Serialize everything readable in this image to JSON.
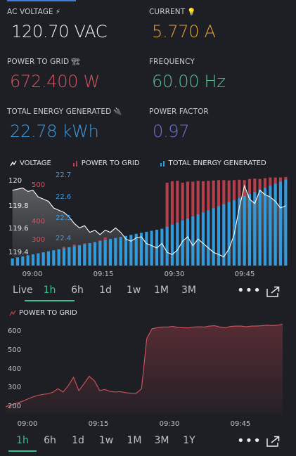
{
  "metrics": [
    {
      "label": "AC VOLTAGE",
      "icon": "lightning-icon",
      "icon_glyph": "⚡",
      "value": "120.70 VAC",
      "color": "#f2f3f5"
    },
    {
      "label": "CURRENT",
      "icon": "lightbulb-icon",
      "icon_glyph": "💡",
      "value": "5.770 A",
      "color": "#e3a03c"
    },
    {
      "label": "POWER TO GRID",
      "icon": "power-tower-icon",
      "icon_glyph": "🏗",
      "value": "672.400 W",
      "color": "#d6525f"
    },
    {
      "label": "FREQUENCY",
      "icon": "",
      "icon_glyph": "",
      "value": "60.00 Hz",
      "color": "#56c08f"
    },
    {
      "label": "TOTAL ENERGY GENERATED",
      "icon": "plug-icon",
      "icon_glyph": "🔌",
      "value": "22.78 kWh",
      "color": "#3e9ae0"
    },
    {
      "label": "POWER FACTOR",
      "icon": "",
      "icon_glyph": "",
      "value": "0.97",
      "color": "#6f73d6"
    }
  ],
  "legend": {
    "voltage": "VOLTAGE",
    "power": "POWER TO GRID",
    "energy": "TOTAL ENERGY GENERATED"
  },
  "colors": {
    "voltage": "#ffffff",
    "power": "#b5404d",
    "energy": "#2f9bdc",
    "active": "#3cc08e"
  },
  "range1": [
    "Live",
    "1h",
    "6h",
    "1d",
    "1w",
    "1M",
    "3M"
  ],
  "range1_active": "1h",
  "range2": [
    "1h",
    "6h",
    "1d",
    "1w",
    "1M",
    "3M",
    "1Y"
  ],
  "range2_active": "1h",
  "more_label": "•••",
  "chart_data": [
    {
      "type": "bar",
      "x_ticks": [
        "09:00",
        "09:15",
        "09:30",
        "09:45"
      ],
      "y_ticks_voltage": [
        "120",
        "119.8",
        "119.6",
        "119.4"
      ],
      "y_ticks_power": [
        "500",
        "400",
        "300"
      ],
      "y_ticks_energy": [
        "22.7",
        "22.6",
        "22.5",
        "22.4"
      ],
      "series": [
        {
          "name": "VOLTAGE",
          "kind": "line",
          "values": [
            119.98,
            119.99,
            120.0,
            119.97,
            119.98,
            119.92,
            119.9,
            119.88,
            119.82,
            119.8,
            119.78,
            119.74,
            119.68,
            119.64,
            119.66,
            119.6,
            119.62,
            119.58,
            119.62,
            119.6,
            119.64,
            119.6,
            119.54,
            119.52,
            119.55,
            119.56,
            119.5,
            119.48,
            119.46,
            119.5,
            119.42,
            119.4,
            119.44,
            119.52,
            119.56,
            119.48,
            119.54,
            119.5,
            119.46,
            119.42,
            119.4,
            119.38,
            119.45,
            119.58,
            119.82,
            120.02,
            119.9,
            119.86,
            119.98,
            119.94,
            119.92,
            119.88,
            119.82,
            119.84
          ]
        },
        {
          "name": "POWER TO GRID",
          "kind": "bar",
          "values": [
            222,
            226,
            232,
            240,
            248,
            258,
            266,
            270,
            276,
            282,
            300,
            296,
            312,
            292,
            318,
            302,
            322,
            334,
            350,
            318,
            306,
            310,
            312,
            316,
            312,
            310,
            300,
            296,
            296,
            300,
            640,
            648,
            650,
            640,
            646,
            646,
            650,
            648,
            650,
            652,
            654,
            654,
            652,
            654,
            656,
            654,
            660,
            662,
            660,
            664,
            668,
            668,
            668,
            670
          ]
        },
        {
          "name": "TOTAL ENERGY GENERATED",
          "kind": "bar",
          "values": [
            22.335,
            22.34,
            22.345,
            22.35,
            22.355,
            22.36,
            22.365,
            22.37,
            22.375,
            22.38,
            22.385,
            22.39,
            22.395,
            22.4,
            22.405,
            22.41,
            22.415,
            22.42,
            22.425,
            22.43,
            22.435,
            22.44,
            22.445,
            22.45,
            22.455,
            22.46,
            22.465,
            22.47,
            22.475,
            22.48,
            22.49,
            22.5,
            22.51,
            22.52,
            22.53,
            22.54,
            22.55,
            22.56,
            22.57,
            22.58,
            22.59,
            22.6,
            22.61,
            22.62,
            22.63,
            22.64,
            22.65,
            22.66,
            22.67,
            22.68,
            22.69,
            22.7,
            22.71,
            22.72
          ]
        }
      ],
      "ylim_voltage": [
        119.3,
        120.15
      ],
      "ylim_power": [
        200,
        700
      ],
      "ylim_energy": [
        22.3,
        22.76
      ]
    },
    {
      "type": "area",
      "title": "POWER TO GRID",
      "x_ticks": [
        "09:00",
        "09:15",
        "09:30",
        "09:45"
      ],
      "y_ticks": [
        "600",
        "500",
        "400",
        "300",
        "200"
      ],
      "ylim": [
        160,
        670
      ],
      "series": [
        {
          "name": "POWER TO GRID",
          "values": [
            200,
            210,
            218,
            228,
            240,
            252,
            262,
            268,
            272,
            280,
            300,
            282,
            318,
            364,
            290,
            328,
            370,
            344,
            290,
            296,
            285,
            282,
            284,
            278,
            275,
            275,
            300,
            580,
            635,
            640,
            645,
            645,
            648,
            642,
            640,
            640,
            645,
            646,
            645,
            650,
            652,
            645,
            640,
            648,
            650,
            650,
            646,
            650,
            650,
            652,
            655,
            653,
            655,
            660
          ]
        }
      ]
    }
  ]
}
